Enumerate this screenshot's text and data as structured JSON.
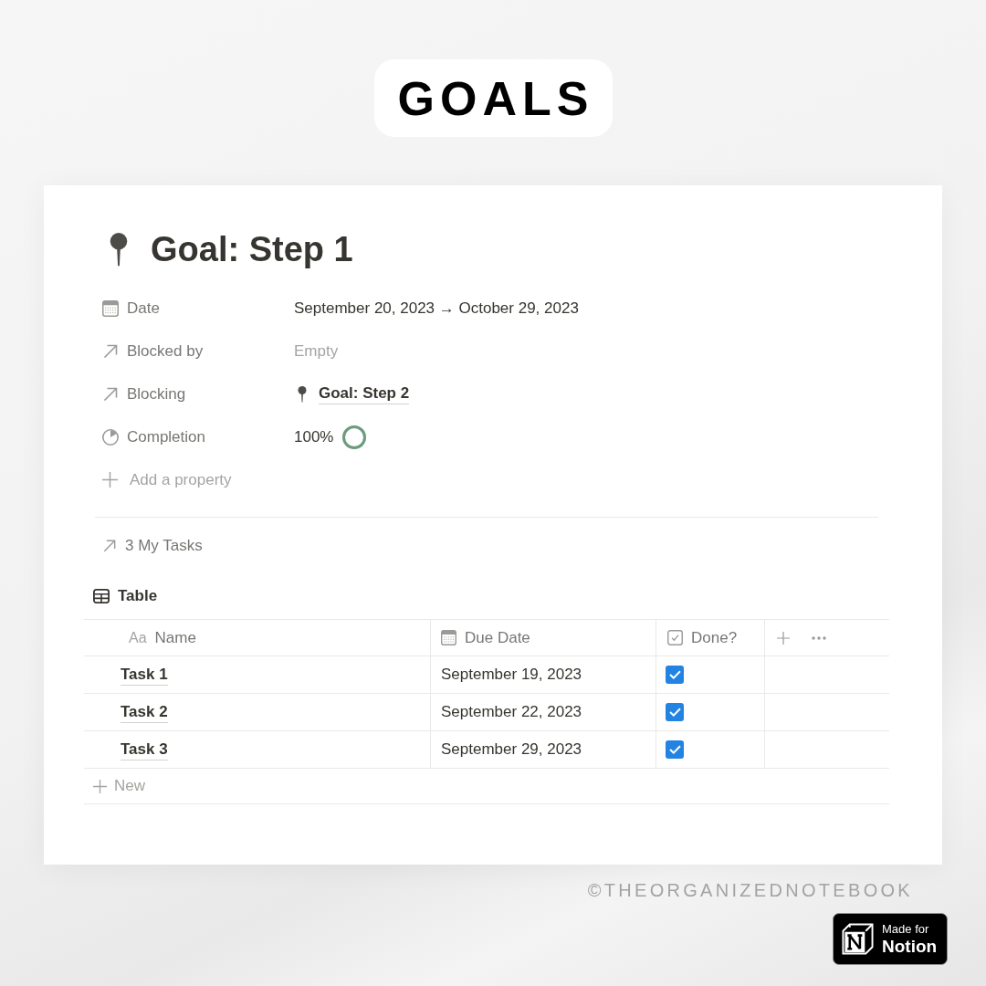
{
  "banner": {
    "title": "GOALS"
  },
  "page": {
    "title": "Goal: Step 1",
    "properties": [
      {
        "kind": "date",
        "label": "Date",
        "value": "September 20, 2023 → October 29, 2023"
      },
      {
        "kind": "relation",
        "label": "Blocked by",
        "placeholder": "Empty"
      },
      {
        "kind": "relation",
        "label": "Blocking",
        "value": "Goal: Step 2"
      },
      {
        "kind": "rollup",
        "label": "Completion",
        "value": "100%",
        "level": 1
      }
    ],
    "add_property": "Add a property"
  },
  "related": {
    "label": "3 My Tasks"
  },
  "table_view": {
    "tab": "Table",
    "columns": [
      {
        "kind": "title",
        "icon_text": "Aa",
        "label": "Name"
      },
      {
        "kind": "date",
        "label": "Due Date"
      },
      {
        "kind": "checkbox",
        "label": "Done?"
      }
    ],
    "rows": [
      {
        "name": "Task 1",
        "due_date": "September 19, 2023",
        "done": true
      },
      {
        "name": "Task 2",
        "due_date": "September 22, 2023",
        "done": true
      },
      {
        "name": "Task 3",
        "due_date": "September 29, 2023",
        "done": true
      }
    ],
    "new_row": "New"
  },
  "footer": {
    "copyright": "©THEORGANIZEDNOTEBOOK",
    "badge": {
      "line_1": "Made for",
      "line_2": "Notion"
    }
  }
}
